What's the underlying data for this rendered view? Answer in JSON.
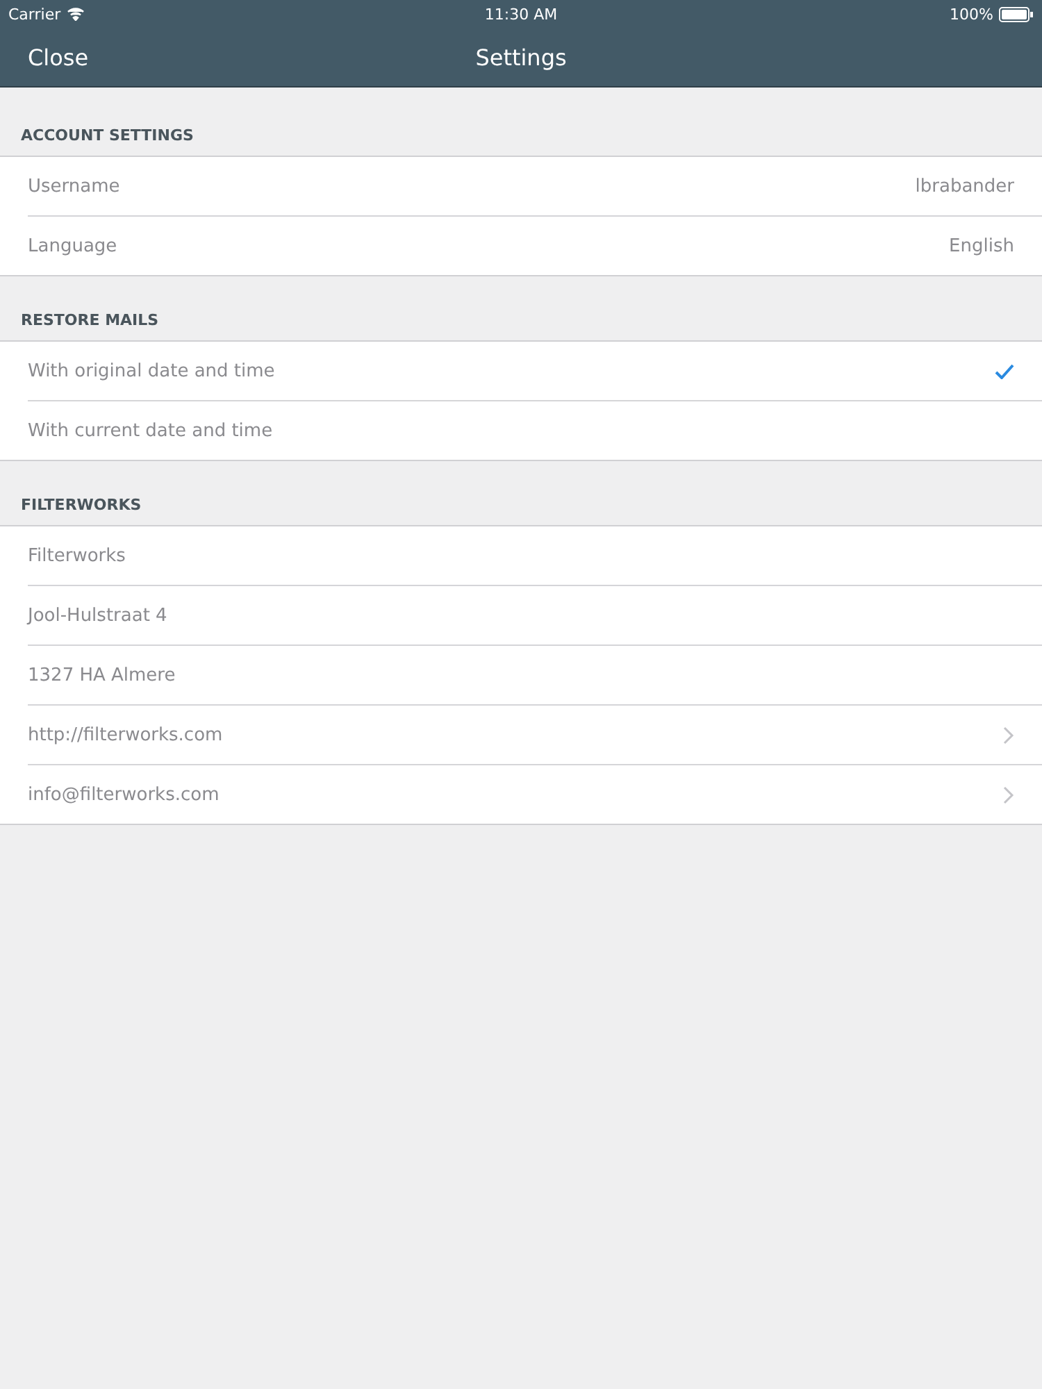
{
  "status_bar": {
    "carrier": "Carrier",
    "time": "11:30 AM",
    "battery": "100%"
  },
  "nav": {
    "close": "Close",
    "title": "Settings"
  },
  "sections": [
    {
      "header": "ACCOUNT SETTINGS",
      "rows": [
        {
          "kind": "value",
          "label": "Username",
          "value": "lbrabander"
        },
        {
          "kind": "value",
          "label": "Language",
          "value": "English"
        }
      ]
    },
    {
      "header": "RESTORE MAILS",
      "rows": [
        {
          "kind": "option",
          "label": "With original date and time",
          "selected": true
        },
        {
          "kind": "option",
          "label": "With current date and time",
          "selected": false
        }
      ]
    },
    {
      "header": "FILTERWORKS",
      "rows": [
        {
          "kind": "text",
          "label": "Filterworks"
        },
        {
          "kind": "text",
          "label": "Jool-Hulstraat 4"
        },
        {
          "kind": "text",
          "label": "1327 HA Almere"
        },
        {
          "kind": "link",
          "label": "http://filterworks.com"
        },
        {
          "kind": "link",
          "label": "info@filterworks.com"
        }
      ]
    }
  ]
}
